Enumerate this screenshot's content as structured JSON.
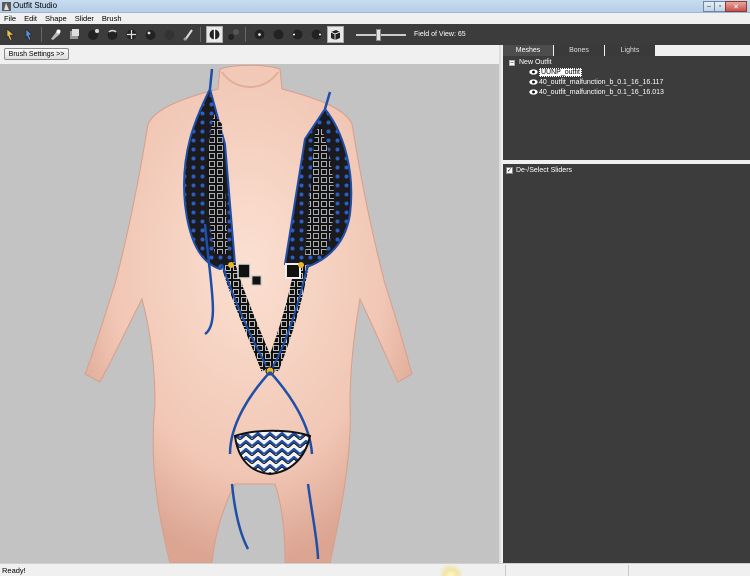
{
  "window": {
    "title": "Outfit Studio",
    "minimize_glyph": "–",
    "maximize_glyph": "▫",
    "close_glyph": "✕"
  },
  "menu": [
    "File",
    "Edit",
    "Shape",
    "Slider",
    "Brush"
  ],
  "toolbar": {
    "field_of_view_label": "Field of View: 65",
    "field_of_view_value": 65,
    "buttons": [
      "select-tool-icon",
      "transform-tool-icon",
      "mask-brush-icon",
      "unmask-brush-icon",
      "inflate-brush-icon",
      "deflate-brush-icon",
      "move-brush-icon",
      "smooth-brush-icon",
      "weight-brush-icon",
      "color-brush-icon",
      "mirror-x-icon",
      "connected-only-icon",
      "view-front-icon",
      "view-left-icon",
      "view-back-icon",
      "view-right-icon",
      "lighting-icon"
    ]
  },
  "viewport": {
    "brush_settings_label": "Brush Settings >>",
    "background_color": "#c3c3c3"
  },
  "panel": {
    "tabs": [
      "Meshes",
      "Bones",
      "Lights"
    ],
    "selected_tab": "Meshes",
    "tree": {
      "root_toggle": "–",
      "root": "New Outfit",
      "items": [
        {
          "label": "UUNP_outfit",
          "selected": true
        },
        {
          "label": "40_outfit_malfunction_b_0.1_16_16.117",
          "selected": false
        },
        {
          "label": "40_outfit_malfunction_b_0.1_16_16.013",
          "selected": false
        }
      ]
    },
    "sliders_header": "De-/Select Sliders",
    "sliders_checkbox_glyph": "✓"
  },
  "status": {
    "text": "Ready!"
  },
  "colors": {
    "panel_dark": "#3c3c3c",
    "toolbar": "#3c3c3c",
    "skin": "#f1cdbb",
    "outfit_blue": "#1f4fa8"
  }
}
